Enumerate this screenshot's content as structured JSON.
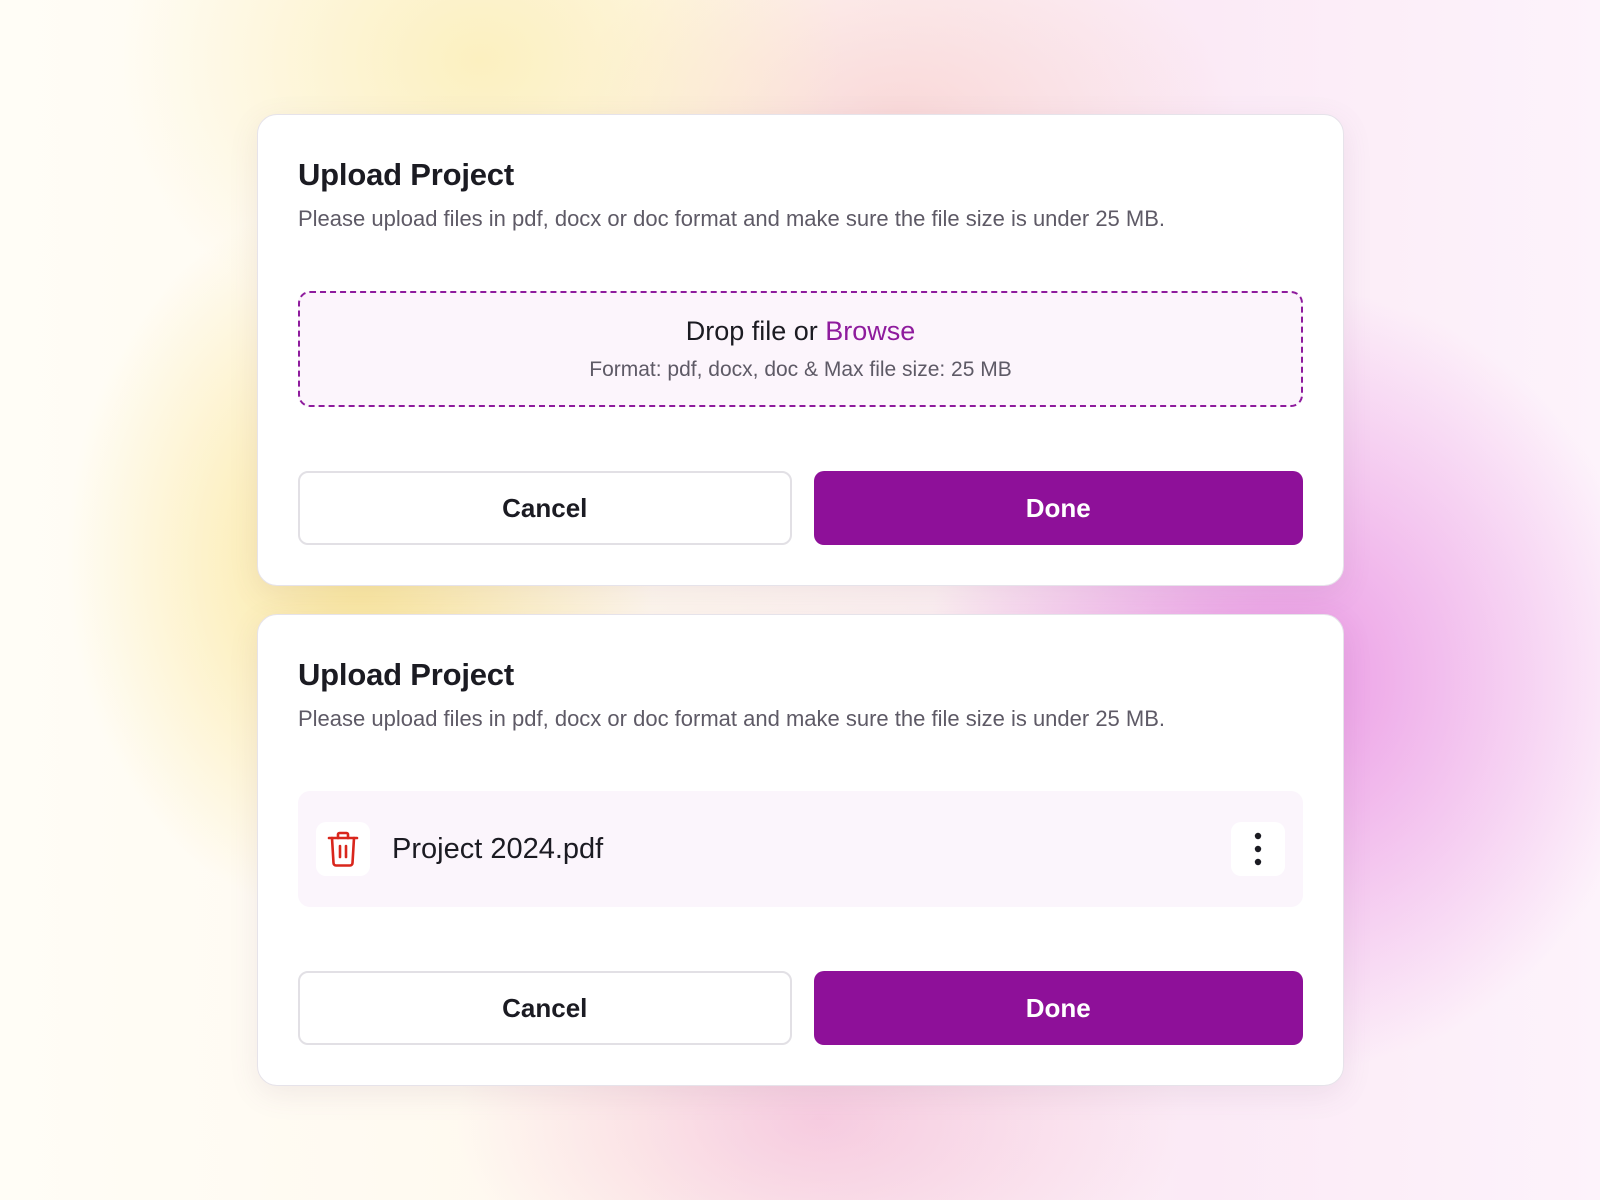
{
  "colors": {
    "accent": "#8e1099",
    "browse_link": "#8e1b9d",
    "delete_icon": "#d9261c",
    "dropzone_bg": "#fcf5fc"
  },
  "upload_card": {
    "title": "Upload Project",
    "subtitle": "Please upload files in pdf, docx or doc format and make sure the file size is under 25 MB.",
    "dropzone": {
      "prompt": "Drop file or",
      "browse_label": "Browse",
      "hint": "Format: pdf, docx, doc & Max file size: 25 MB"
    },
    "cancel_label": "Cancel",
    "done_label": "Done"
  },
  "uploaded_card": {
    "title": "Upload Project",
    "subtitle": "Please upload files in pdf, docx or doc format and make sure the file size is under 25 MB.",
    "file": {
      "name": "Project 2024.pdf",
      "delete_icon": "trash-icon",
      "menu_icon": "more-vertical-icon"
    },
    "cancel_label": "Cancel",
    "done_label": "Done"
  }
}
